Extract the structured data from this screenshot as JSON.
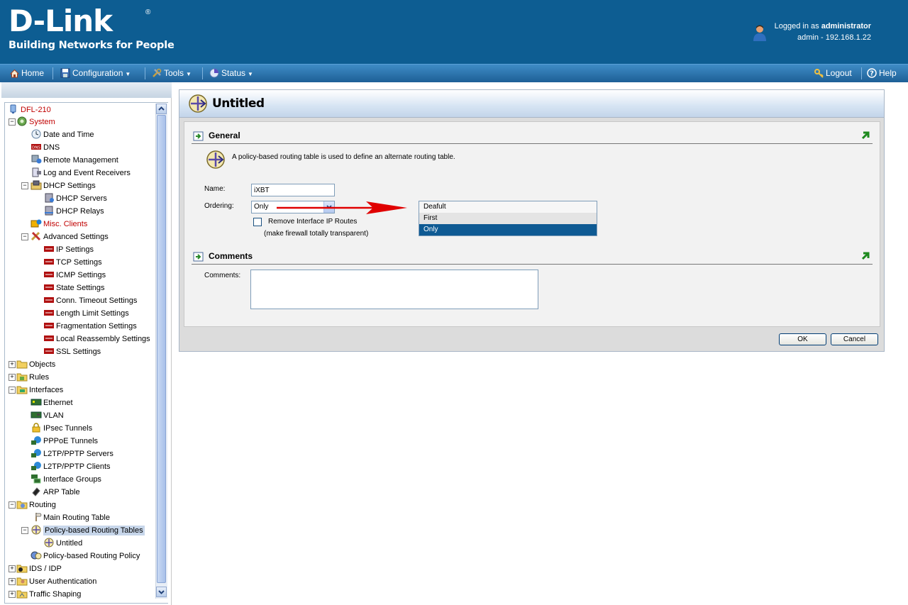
{
  "brand": {
    "logo": "D-Link",
    "registered": "®",
    "tagline": "Building Networks for People"
  },
  "login": {
    "prefix": "Logged in as",
    "user": "administrator",
    "session": "admin - 192.168.1.22"
  },
  "nav": {
    "home": "Home",
    "configuration": "Configuration",
    "tools": "Tools",
    "status": "Status",
    "logout": "Logout",
    "help": "Help"
  },
  "tree": {
    "root": "DFL-210",
    "system": "System",
    "date_time": "Date and Time",
    "dns": "DNS",
    "remote_mgmt": "Remote Management",
    "log_receivers": "Log and Event Receivers",
    "dhcp_settings": "DHCP Settings",
    "dhcp_servers": "DHCP Servers",
    "dhcp_relays": "DHCP Relays",
    "misc_clients": "Misc. Clients",
    "advanced_settings": "Advanced Settings",
    "ip_settings": "IP Settings",
    "tcp_settings": "TCP Settings",
    "icmp_settings": "ICMP Settings",
    "state_settings": "State Settings",
    "conn_timeout": "Conn. Timeout Settings",
    "length_limit": "Length Limit Settings",
    "fragmentation": "Fragmentation Settings",
    "local_reassembly": "Local Reassembly Settings",
    "ssl_settings": "SSL Settings",
    "objects": "Objects",
    "rules": "Rules",
    "interfaces": "Interfaces",
    "ethernet": "Ethernet",
    "vlan": "VLAN",
    "ipsec": "IPsec Tunnels",
    "pppoe": "PPPoE Tunnels",
    "l2tp_servers": "L2TP/PPTP Servers",
    "l2tp_clients": "L2TP/PPTP Clients",
    "iface_groups": "Interface Groups",
    "arp_table": "ARP Table",
    "routing": "Routing",
    "main_routing": "Main Routing Table",
    "pbr_tables": "Policy-based Routing Tables",
    "untitled": "Untitled",
    "pbr_policy": "Policy-based Routing Policy",
    "ids_idp": "IDS / IDP",
    "user_auth": "User Authentication",
    "traffic_shaping": "Traffic Shaping"
  },
  "dialog": {
    "title": "Untitled",
    "general": {
      "heading": "General",
      "description": "A policy-based routing table is used to define an alternate routing table.",
      "name_label": "Name:",
      "name_value": "iXBT",
      "ordering_label": "Ordering:",
      "ordering_value": "Only",
      "ordering_options": [
        "Deafult",
        "First",
        "Only"
      ],
      "remove_routes_label": "Remove Interface IP Routes",
      "remove_routes_hint": "(make firewall totally transparent)",
      "remove_routes_checked": false
    },
    "comments": {
      "heading": "Comments",
      "label": "Comments:",
      "value": ""
    },
    "ok": "OK",
    "cancel": "Cancel"
  },
  "colors": {
    "header_bg": "#0d5d92",
    "highlight": "#0e5a93",
    "tree_red": "#c00000",
    "arrow": "#e00000"
  }
}
